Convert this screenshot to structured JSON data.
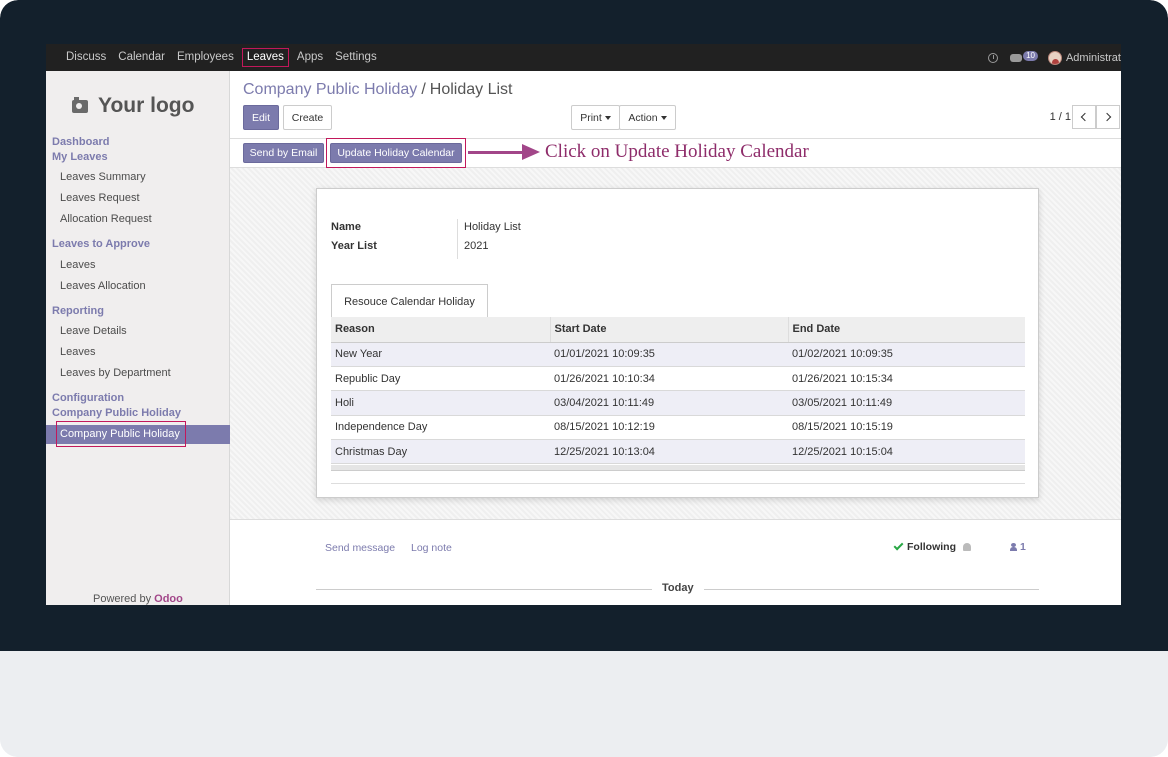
{
  "nav": {
    "items": [
      "Discuss",
      "Calendar",
      "Employees",
      "Leaves",
      "Apps",
      "Settings"
    ],
    "active": "Leaves",
    "message_count": "10",
    "user": "Administrat"
  },
  "sidebar": {
    "logo_text": "Your logo",
    "dashboard": "Dashboard",
    "my_leaves": "My Leaves",
    "my_leaves_items": [
      "Leaves Summary",
      "Leaves Request",
      "Allocation Request"
    ],
    "to_approve": "Leaves to Approve",
    "to_approve_items": [
      "Leaves",
      "Leaves Allocation"
    ],
    "reporting": "Reporting",
    "reporting_items": [
      "Leave Details",
      "Leaves",
      "Leaves by Department"
    ],
    "configuration": "Configuration",
    "company_holiday_head": "Company Public Holiday",
    "active_item": "Company Public Holiday",
    "powered_by": "Powered by",
    "powered_brand": "Odoo"
  },
  "main": {
    "breadcrumb_parent": "Company Public Holiday",
    "breadcrumb_sep": "/",
    "breadcrumb_current": "Holiday List",
    "edit_label": "Edit",
    "create_label": "Create",
    "print_label": "Print",
    "action_label": "Action",
    "pager": "1 / 1",
    "send_email_label": "Send by Email",
    "update_calendar_label": "Update Holiday Calendar",
    "annotation": "Click on Update Holiday Calendar"
  },
  "form": {
    "name_label": "Name",
    "name_value": "Holiday List",
    "year_label": "Year List",
    "year_value": "2021",
    "tab_label": "Resouce Calendar Holiday",
    "columns": [
      "Reason",
      "Start Date",
      "End Date"
    ],
    "rows": [
      [
        "New Year",
        "01/01/2021 10:09:35",
        "01/02/2021 10:09:35"
      ],
      [
        "Republic Day",
        "01/26/2021 10:10:34",
        "01/26/2021 10:15:34"
      ],
      [
        "Holi",
        "03/04/2021 10:11:49",
        "03/05/2021 10:11:49"
      ],
      [
        "Independence Day",
        "08/15/2021 10:12:19",
        "08/15/2021 10:15:19"
      ],
      [
        "Christmas Day",
        "12/25/2021 10:13:04",
        "12/25/2021 10:15:04"
      ]
    ]
  },
  "chatter": {
    "send_message": "Send message",
    "log_note": "Log note",
    "following": "Following",
    "followers": "1",
    "today": "Today"
  }
}
